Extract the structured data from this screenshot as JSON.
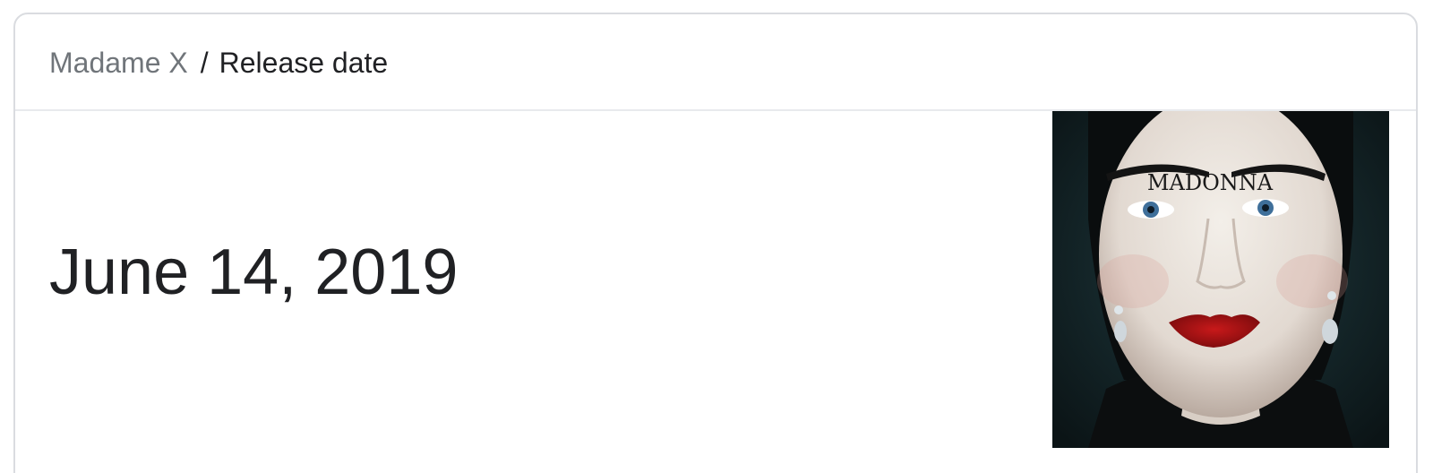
{
  "breadcrumb": {
    "parent": "Madame X",
    "separator": "/",
    "current": "Release date"
  },
  "answer": {
    "value": "June 14, 2019"
  },
  "thumbnail": {
    "alt": "Madame X album cover",
    "overlay_text": "MADONNA"
  },
  "colors": {
    "border": "#dadce0",
    "muted_text": "#70757a",
    "primary_text": "#202124"
  }
}
